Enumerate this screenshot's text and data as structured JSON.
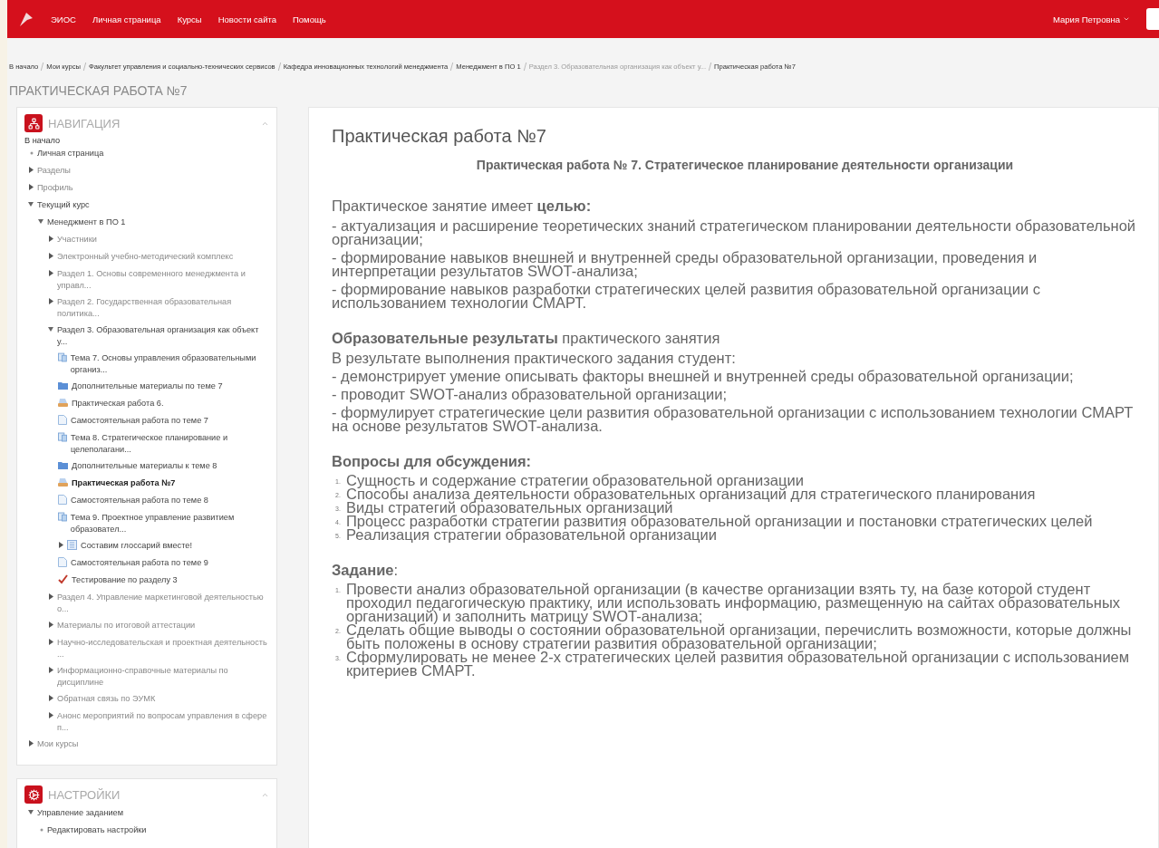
{
  "topbar": {
    "menu": [
      "ЭИОС",
      "Личная страница",
      "Курсы",
      "Новости сайта",
      "Помощь"
    ],
    "user": "Мария Петровна"
  },
  "breadcrumb": [
    {
      "label": "В начало",
      "dimmed": false
    },
    {
      "label": "Мои курсы",
      "dimmed": false
    },
    {
      "label": "Факультет управления и социально-технических сервисов",
      "dimmed": false
    },
    {
      "label": "Кафедра инновационных технологий менеджмента",
      "dimmed": false
    },
    {
      "label": "Менеджмент в ПО 1",
      "dimmed": false
    },
    {
      "label": "Раздел 3. Образовательная организация как объект у...",
      "dimmed": true
    },
    {
      "label": "Практическая работа №7",
      "dimmed": false
    }
  ],
  "page_heading": "ПРАКТИЧЕСКАЯ РАБОТА №7",
  "navigation": {
    "title": "НАВИГАЦИЯ",
    "home": "В начало",
    "items": [
      {
        "label": "Личная страница",
        "kind": "link"
      },
      {
        "label": "Разделы",
        "kind": "branch",
        "expanded": false
      },
      {
        "label": "Профиль",
        "kind": "branch",
        "expanded": false
      },
      {
        "label": "Текущий курс",
        "kind": "branch",
        "expanded": true,
        "children": [
          {
            "label": "Менеджмент в ПО 1",
            "kind": "branch",
            "expanded": true,
            "children": [
              {
                "label": "Участники",
                "kind": "branch",
                "expanded": false
              },
              {
                "label": "Электронный учебно-методический комплекс",
                "kind": "branch",
                "expanded": false
              },
              {
                "label": "Раздел 1. Основы современного менеджмента и управл...",
                "kind": "branch",
                "expanded": false
              },
              {
                "label": "Раздел 2. Государственная образовательная политика...",
                "kind": "branch",
                "expanded": false
              },
              {
                "label": "Раздел 3. Образовательная организация как объект у...",
                "kind": "branch",
                "expanded": true,
                "children": [
                  {
                    "label": "Тема 7. Основы управления образовательными организ...",
                    "kind": "topic",
                    "selected": false
                  },
                  {
                    "label": "Дополнительные материалы по теме 7",
                    "kind": "folder",
                    "selected": false
                  },
                  {
                    "label": "Практическая работа 6.",
                    "kind": "assign",
                    "selected": false
                  },
                  {
                    "label": "Самостоятельная работа по теме 7",
                    "kind": "page",
                    "selected": false
                  },
                  {
                    "label": "Тема 8. Стратегическое планирование и целеполагани...",
                    "kind": "topic",
                    "selected": false
                  },
                  {
                    "label": "Дополнительные материалы к теме 8",
                    "kind": "folder",
                    "selected": false
                  },
                  {
                    "label": "Практическая работа №7",
                    "kind": "assign",
                    "selected": true
                  },
                  {
                    "label": "Самостоятельная работа по теме 8",
                    "kind": "page",
                    "selected": false
                  },
                  {
                    "label": "Тема 9. Проектное управление развитием образовател...",
                    "kind": "topic",
                    "selected": false
                  },
                  {
                    "label": "Составим глоссарий вместе!",
                    "kind": "glossary",
                    "selected": false,
                    "expanded": false
                  },
                  {
                    "label": "Самостоятельная работа по теме 9",
                    "kind": "page",
                    "selected": false
                  },
                  {
                    "label": "Тестирование по разделу 3",
                    "kind": "quiz",
                    "selected": false
                  }
                ]
              },
              {
                "label": "Раздел 4. Управление маркетинговой деятельностью о...",
                "kind": "branch",
                "expanded": false
              },
              {
                "label": "Материалы по итоговой аттестации",
                "kind": "branch",
                "expanded": false
              },
              {
                "label": "Научно-исследовательская и проектная деятельность ...",
                "kind": "branch",
                "expanded": false
              },
              {
                "label": "Информационно-справочные материалы по дисциплине",
                "kind": "branch",
                "expanded": false
              },
              {
                "label": "Обратная связь по ЭУМК",
                "kind": "branch",
                "expanded": false
              },
              {
                "label": "Анонс мероприятий по вопросам управления в сфере п...",
                "kind": "branch",
                "expanded": false
              }
            ]
          }
        ]
      },
      {
        "label": "Мои курсы",
        "kind": "branch",
        "expanded": false
      }
    ]
  },
  "settings": {
    "title": "НАСТРОЙКИ",
    "items": [
      {
        "label": "Управление заданием",
        "kind": "branch",
        "expanded": true,
        "children": [
          {
            "label": "Редактировать настройки",
            "kind": "link"
          }
        ]
      }
    ]
  },
  "main": {
    "title": "Практическая работа №7",
    "subtitle": "Практическая работа № 7. Стратегическое **планирование** деятельности организации",
    "blocks": [
      {
        "kind": "lead",
        "text": "Практическое занятие имеет **целью:**"
      },
      {
        "kind": "para",
        "text": "-  актуализация и расширение теоретических знаний стратегическом планировании деятельности образовательной организации;"
      },
      {
        "kind": "para",
        "text": "- формирование навыков внешней и внутренней среды образовательной организации, проведения и интерпретации результатов SWOT-анализа;"
      },
      {
        "kind": "para",
        "text": "- формирование навыков разработки стратегических целей развития образовательной организации с использованием технологии СМАРТ."
      },
      {
        "kind": "lead",
        "text": "**Образовательные результаты** практического занятия"
      },
      {
        "kind": "para",
        "text": "В результате выполнения практического задания студент:"
      },
      {
        "kind": "para",
        "text": "- демонстрирует умение описывать факторы внешней и внутренней среды образовательной организации;"
      },
      {
        "kind": "para",
        "text": "- проводит SWOT-анализ образовательной организации;"
      },
      {
        "kind": "para",
        "text": "- формулирует стратегические цели развития образовательной организации с использованием технологии СМАРТ на основе результатов SWOT-анализа."
      },
      {
        "kind": "heading",
        "text": "Вопросы для обсуждения:"
      },
      {
        "kind": "list",
        "items": [
          {
            "number": "1.",
            "text": "Сущность и содержание стратегии образовательной организации"
          },
          {
            "number": "2.",
            "text": "Способы анализа деятельности образовательных организаций для стратегического планирования"
          },
          {
            "number": "3.",
            "text": "Виды стратегий образовательных организаций"
          },
          {
            "number": "4.",
            "text": "Процесс разработки стратегии развития образовательной организации и постановки стратегических целей"
          },
          {
            "number": "5.",
            "text": "Реализация стратегии образовательной организации"
          }
        ]
      },
      {
        "kind": "lead",
        "text": "**Задание**:"
      },
      {
        "kind": "list",
        "items": [
          {
            "number": "1.",
            "text": "Провести анализ образовательной организации (в качестве организации взять ту, на базе которой студент проходил педагогическую практику, или использовать информацию, размещенную на сайтах образовательных организаций) и заполнить матрицу SWOT-анализа;"
          },
          {
            "number": "2.",
            "text": "Сделать общие выводы о состоянии образовательной организации, перечислить возможности, которые должны быть положены в основу стратегии развития образовательной организации;"
          },
          {
            "number": "3.",
            "text": "Сформулировать не менее 2-х стратегических целей развития образовательной организации с использованием критериев СМАРТ."
          }
        ]
      }
    ]
  }
}
